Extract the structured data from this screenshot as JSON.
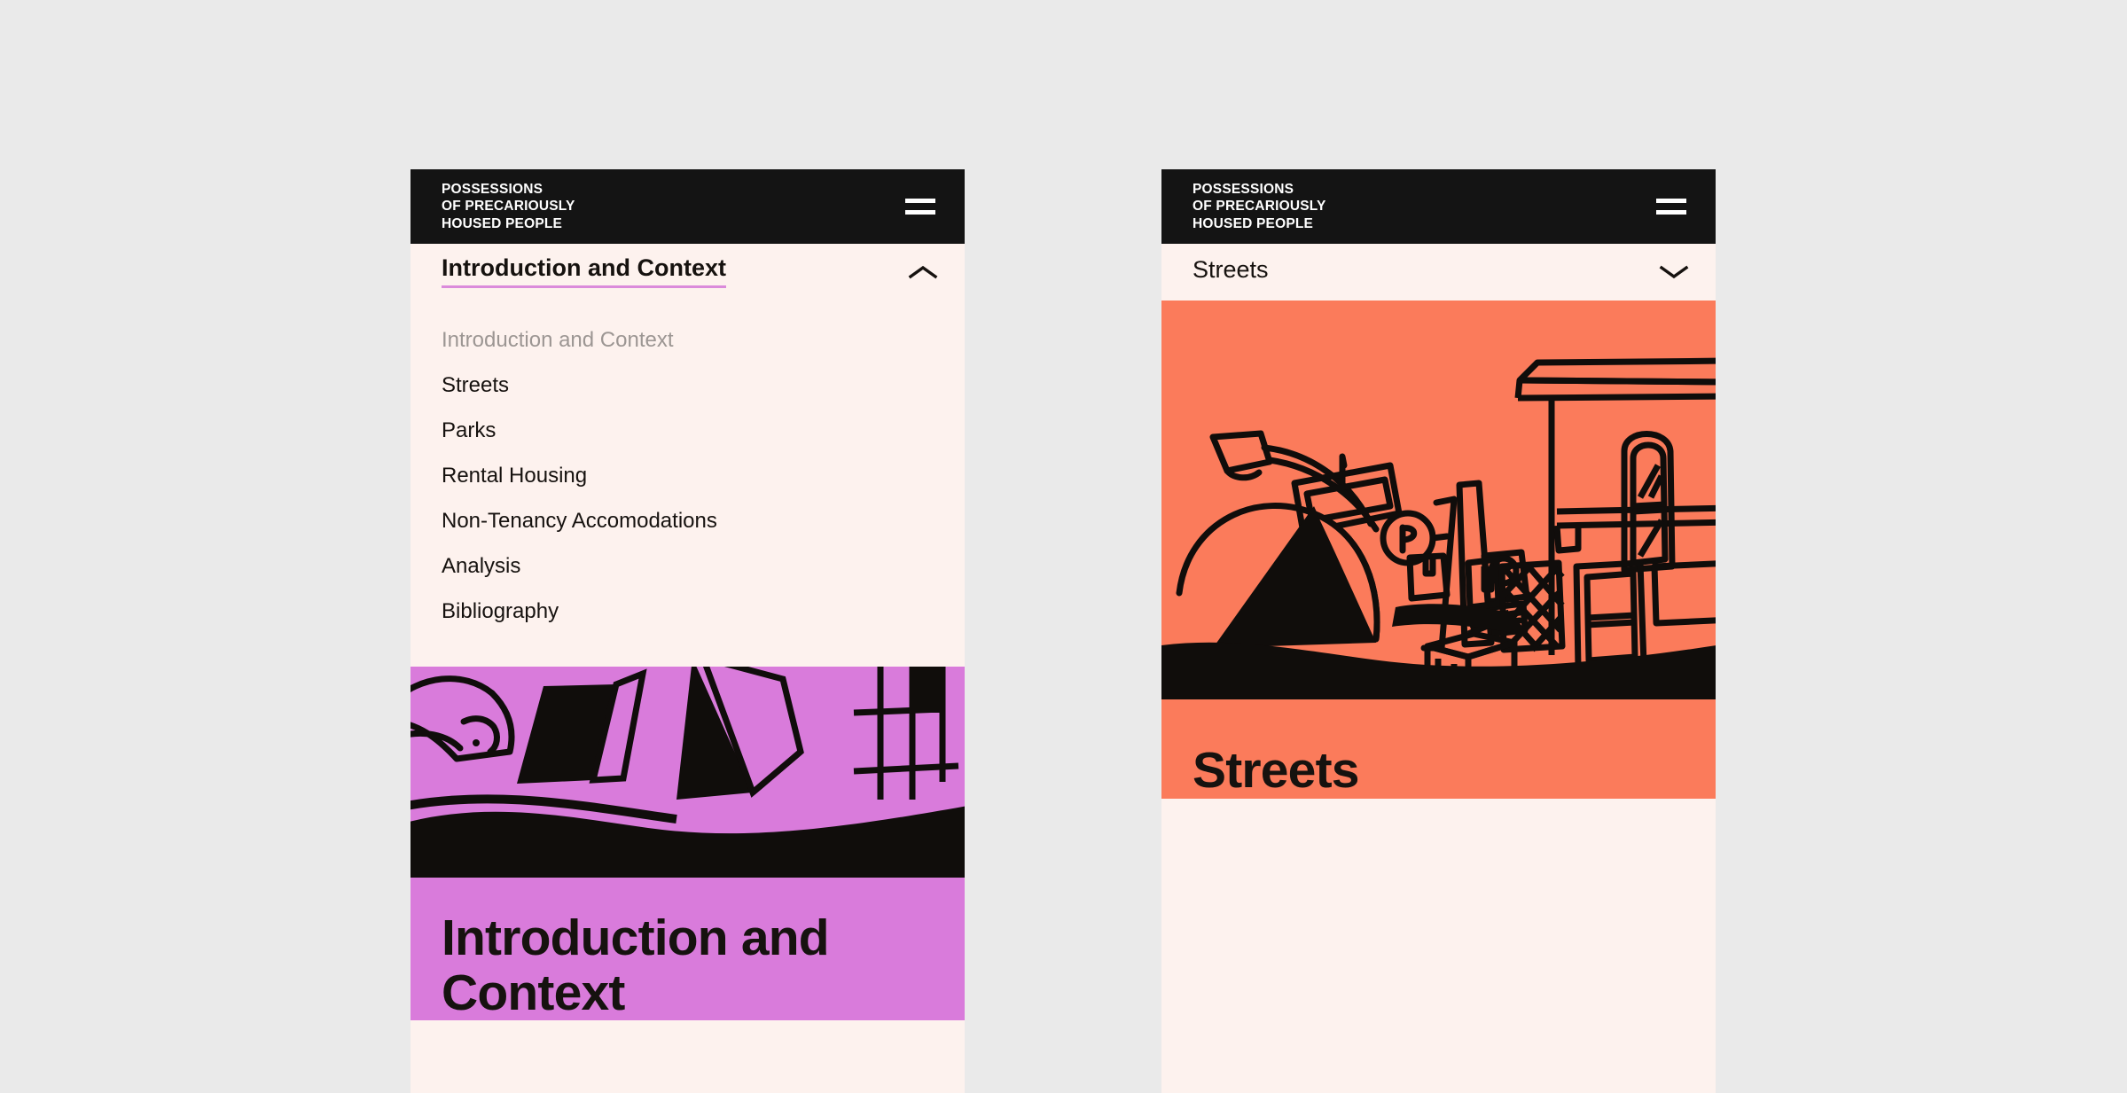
{
  "brand": {
    "title": "POSSESSIONS\nOF PRECARIOUSLY\nHOUSED PEOPLE",
    "menu_icon": "hamburger-icon"
  },
  "colors": {
    "page_background": "#EAEAEA",
    "appbar": "#141414",
    "panel": "#FDF2EE",
    "accent_underline": "#DB8BDB",
    "hero_pink": "#D97BDB",
    "hero_coral": "#FB7B5B",
    "text": "#16120F",
    "muted_text": "#9C9693"
  },
  "left_phone": {
    "dropdown": {
      "selected": "Introduction and Context",
      "state": "open",
      "chevron": "chevron-up-icon",
      "items": [
        {
          "label": "Introduction and Context",
          "current": true
        },
        {
          "label": "Streets",
          "current": false
        },
        {
          "label": "Parks",
          "current": false
        },
        {
          "label": "Rental Housing",
          "current": false
        },
        {
          "label": "Non-Tenancy Accomodations",
          "current": false
        },
        {
          "label": "Analysis",
          "current": false
        },
        {
          "label": "Bibliography",
          "current": false
        }
      ]
    },
    "hero": {
      "title": "Introduction and Context",
      "illustration": "tents-and-belongings-illustration"
    }
  },
  "right_phone": {
    "dropdown": {
      "selected": "Streets",
      "state": "closed",
      "chevron": "chevron-down-icon"
    },
    "hero": {
      "title": "Streets",
      "illustration": "street-scene-tent-streetlamp-storefront-illustration"
    }
  }
}
